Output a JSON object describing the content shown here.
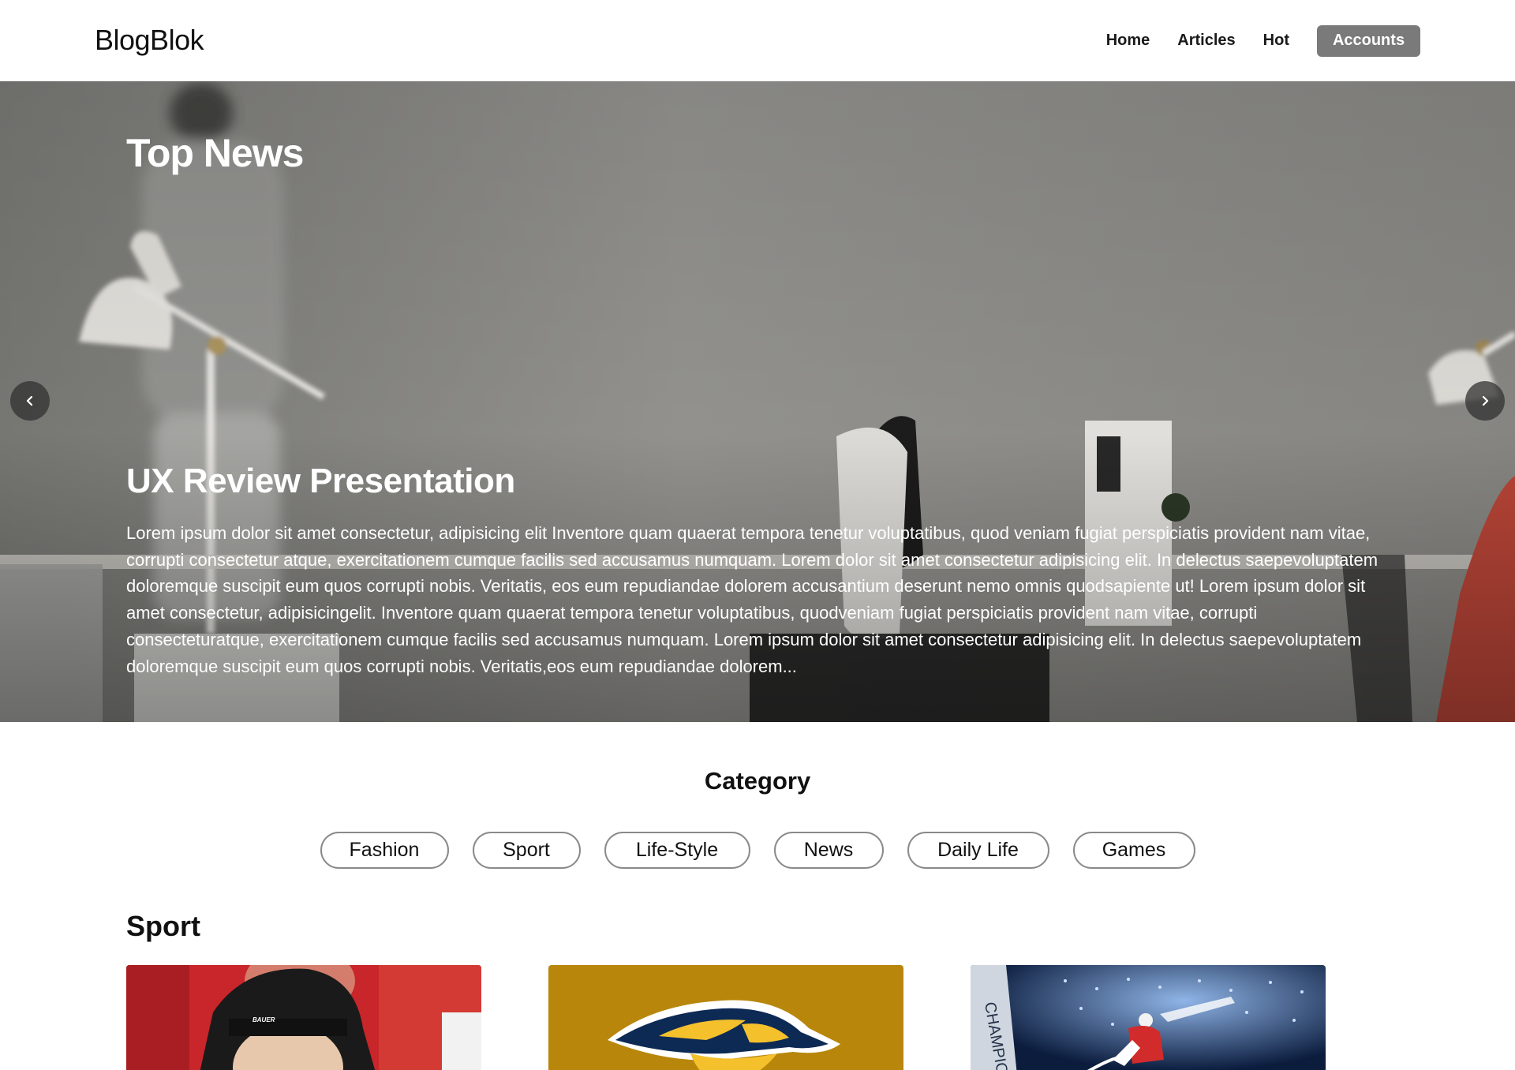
{
  "header": {
    "brand": "BlogBlok",
    "nav": [
      "Home",
      "Articles",
      "Hot"
    ],
    "account_label": "Accounts",
    "account_color": "#7a7a7a"
  },
  "hero": {
    "title": "Top News",
    "article_title": "UX Review Presentation",
    "article_body": "Lorem ipsum dolor sit amet consectetur, adipisicing elit Inventore quam quaerat tempora tenetur voluptatibus, quod veniam fugiat perspiciatis provident nam vitae, corrupti consectetur atque, exercitationem cumque facilis sed accusamus numquam. Lorem dolor sit amet consectetur adipisicing elit. In delectus saepevoluptatem doloremque suscipit eum quos corrupti nobis. Veritatis, eos eum repudiandae dolorem accusantium deserunt nemo omnis quodsapiente ut! Lorem ipsum dolor sit amet consectetur, adipisicingelit. Inventore quam quaerat tempora tenetur voluptatibus, quodveniam fugiat perspiciatis provident nam vitae, corrupti consecteturatque, exercitationem cumque facilis sed accusamus numquam. Lorem ipsum dolor sit amet consectetur adipisicing elit. In delectus saepevoluptatem doloremque suscipit eum quos corrupti nobis. Veritatis,eos eum repudiandae dolorem...",
    "prev_icon": "chevron-left-icon",
    "next_icon": "chevron-right-icon"
  },
  "category": {
    "heading": "Category",
    "chips": [
      "Fashion",
      "Sport",
      "Life-Style",
      "News",
      "Daily Life",
      "Games"
    ]
  },
  "sport": {
    "heading": "Sport",
    "cards": [
      {
        "image": "hockey-player-closeup-image"
      },
      {
        "image": "predators-logo-image"
      },
      {
        "image": "hockey-arena-image"
      }
    ]
  }
}
